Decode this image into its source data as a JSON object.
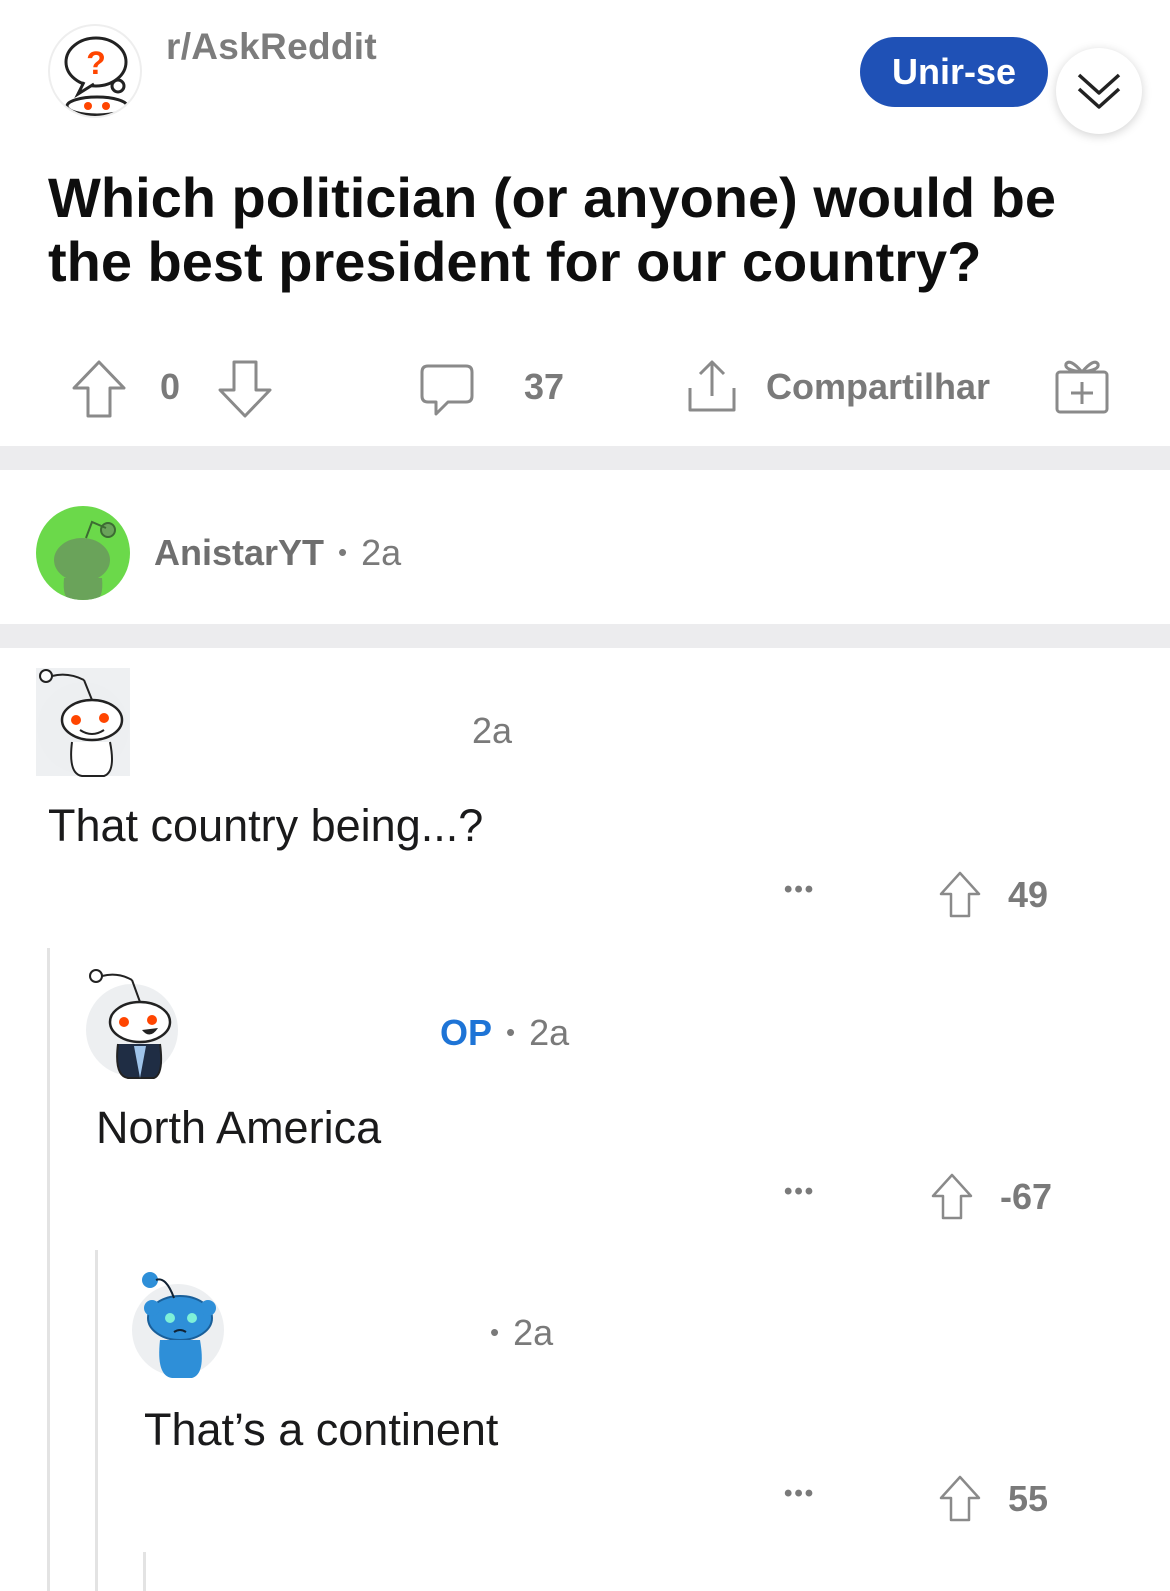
{
  "post": {
    "subreddit": "r/AskReddit",
    "join_label": "Unir-se",
    "title": "Which politician (or anyone) would be the best president for our country?",
    "votes": "0",
    "comments_count": "37",
    "share_label": "Compartilhar"
  },
  "author": {
    "username": "AnistarYT",
    "separator": "•",
    "age": "2a"
  },
  "comments": [
    {
      "age": "2a",
      "text": "That country being...?",
      "more": "•••",
      "votes": "49"
    },
    {
      "op_label": "OP",
      "separator": "•",
      "age": "2a",
      "text": "North America",
      "more": "•••",
      "votes": "-67"
    },
    {
      "separator": "•",
      "age": "2a",
      "text": "That’s a continent",
      "more": "•••",
      "votes": "55"
    }
  ],
  "colors": {
    "join_button": "#1f51b6",
    "op_badge": "#1e74d6",
    "author_avatar_bg": "#6bd94a",
    "blue_avatar": "#2e8fd8",
    "snoo_eye": "#ff4500"
  },
  "icons": [
    "question-subreddit-icon",
    "chevron-double-down-icon",
    "upvote-icon",
    "downvote-icon",
    "comment-icon",
    "share-icon",
    "award-icon",
    "snoo-avatar-icon",
    "more-icon"
  ]
}
